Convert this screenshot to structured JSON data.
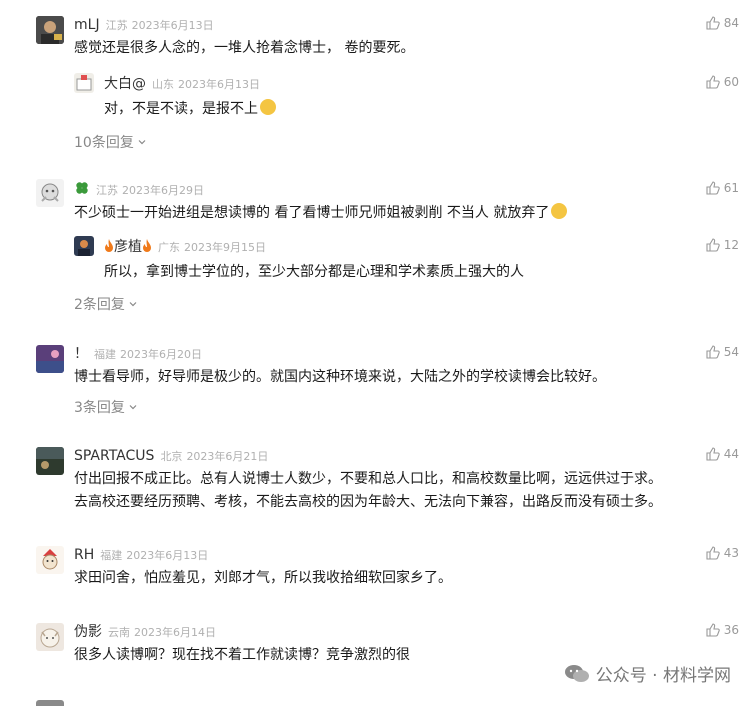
{
  "comments": [
    {
      "name": "mLJ",
      "location": "江苏",
      "date": "2023年6月13日",
      "lines": [
        "感觉还是很多人念的，一堆人抢着念博士， 卷的要死。"
      ],
      "likes": "84",
      "reply": {
        "name": "大白@",
        "location": "山东",
        "date": "2023年6月13日",
        "text": "对，不是不读，是报不上",
        "likes": "60"
      },
      "more": "10条回复"
    },
    {
      "name": "",
      "location": "江苏",
      "date": "2023年6月29日",
      "lines": [
        "不少硕士一开始进组是想读博的 看了看博士师兄师姐被剥削 不当人 就放弃了"
      ],
      "likes": "61",
      "reply": {
        "name": "彦植",
        "location": "广东",
        "date": "2023年9月15日",
        "text": "所以，拿到博士学位的，至少大部分都是心理和学术素质上强大的人",
        "likes": "12"
      },
      "more": "2条回复"
    },
    {
      "name": "！",
      "location": "福建",
      "date": "2023年6月20日",
      "lines": [
        "博士看导师，好导师是极少的。就国内这种环境来说，大陆之外的学校读博会比较好。"
      ],
      "likes": "54",
      "more": "3条回复"
    },
    {
      "name": "SPARTACUS",
      "location": "北京",
      "date": "2023年6月21日",
      "lines": [
        "付出回报不成正比。总有人说博士人数少，不要和总人口比，和高校数量比啊，远远供过于求。",
        "去高校还要经历预聘、考核，不能去高校的因为年龄大、无法向下兼容，出路反而没有硕士多。"
      ],
      "likes": "44"
    },
    {
      "name": "RH",
      "location": "福建",
      "date": "2023年6月13日",
      "lines": [
        "求田问舍，怕应羞见，刘郎才气，所以我收拾细软回家乡了。"
      ],
      "likes": "43"
    },
    {
      "name": "伪影",
      "location": "云南",
      "date": "2023年6月14日",
      "lines": [
        "很多人读博啊？现在找不着工作就读博？竞争激烈的很"
      ],
      "likes": "36"
    }
  ],
  "watermark": {
    "text": "公众号 · 材料学网"
  },
  "icons": {
    "like": "thumbs-up-icon",
    "chevron": "chevron-down-icon",
    "watermark": "wechat-icon"
  },
  "colors": {
    "meta": "#b0b0b0",
    "text": "#1a1a1a",
    "muted": "#888888"
  }
}
